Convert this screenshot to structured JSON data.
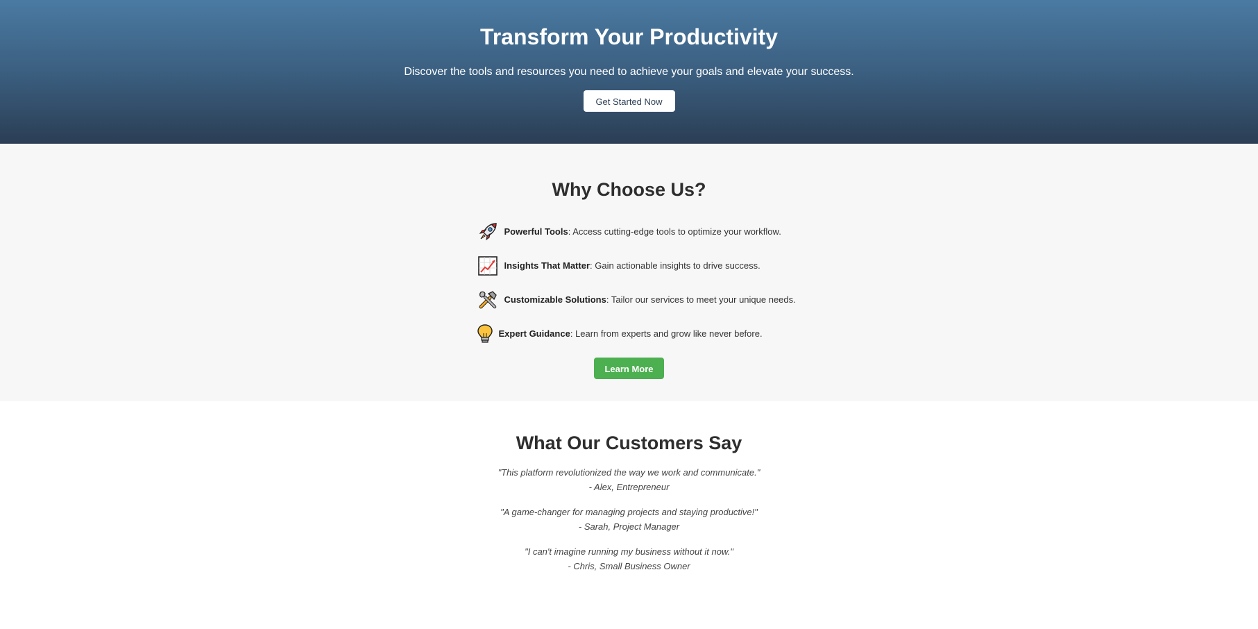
{
  "hero": {
    "title": "Transform Your Productivity",
    "subtitle": "Discover the tools and resources you need to achieve your goals and elevate your success.",
    "cta_label": "Get Started Now",
    "gradient_top": "#4a7aa2",
    "gradient_bottom": "#2b3e55"
  },
  "features": {
    "heading": "Why Choose Us?",
    "items": [
      {
        "icon": "rocket-icon",
        "title": "Powerful Tools",
        "text": ": Access cutting-edge tools to optimize your workflow."
      },
      {
        "icon": "chart-increasing-icon",
        "title": "Insights That Matter",
        "text": ": Gain actionable insights to drive success."
      },
      {
        "icon": "hammer-wrench-icon",
        "title": "Customizable Solutions",
        "text": ": Tailor our services to meet your unique needs."
      },
      {
        "icon": "lightbulb-icon",
        "title": "Expert Guidance",
        "text": ": Learn from experts and grow like never before."
      }
    ],
    "learn_more_label": "Learn More",
    "accent": "#4caf50"
  },
  "testimonials": {
    "heading": "What Our Customers Say",
    "items": [
      {
        "quote": "\"This platform revolutionized the way we work and communicate.\"",
        "author": "- Alex, Entrepreneur"
      },
      {
        "quote": "\"A game-changer for managing projects and staying productive!\"",
        "author": "- Sarah, Project Manager"
      },
      {
        "quote": "\"I can't imagine running my business without it now.\"",
        "author": "- Chris, Small Business Owner"
      }
    ]
  }
}
